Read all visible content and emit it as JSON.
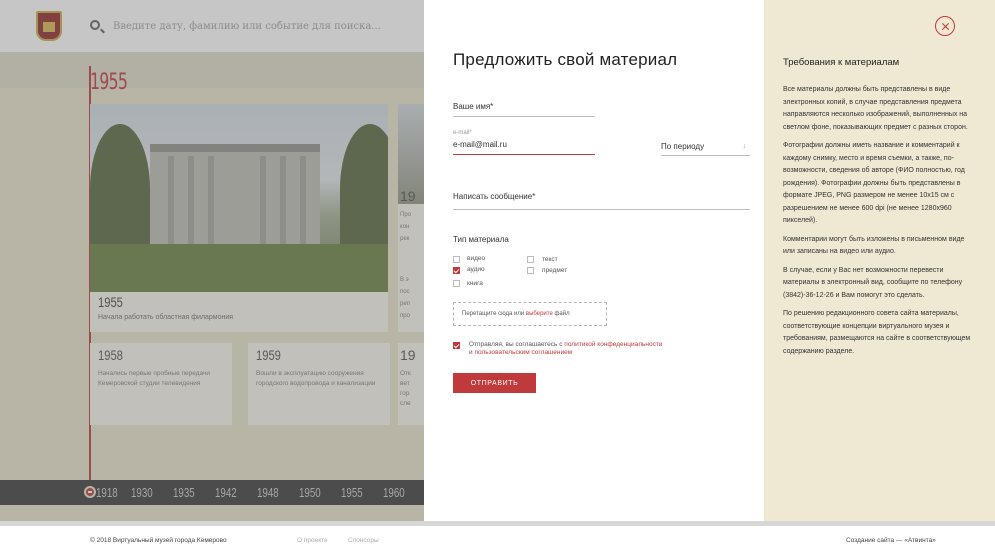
{
  "search": {
    "placeholder": "Введите дату, фамилию или событие для поиска..."
  },
  "timeline": {
    "current_year": "1955",
    "featured": {
      "year": "1955",
      "text": "Начала работать областная филармония"
    },
    "right_card": {
      "year": "19",
      "text_lines": [
        "Про",
        "кон",
        "рек"
      ],
      "text_lines2": [
        "В э",
        "пос",
        "реп",
        "про"
      ]
    },
    "small_cards": [
      {
        "year": "1958",
        "text": "Начались первые пробные передачи Кемеровской студии телевидения"
      },
      {
        "year": "1959",
        "text": "Вошли в эксплуатацию сооружения городского водопровода и канализации"
      }
    ],
    "small_card_partial": {
      "year": "19",
      "text_lines": [
        "Отк",
        "вет",
        "гор",
        "сле"
      ]
    },
    "years": [
      "1918",
      "1930",
      "1935",
      "1942",
      "1948",
      "1950",
      "1955",
      "1960"
    ]
  },
  "form": {
    "title": "Предложить свой материал",
    "name_label": "Ваше имя*",
    "email_label": "e-mail*",
    "email_value": "e-mail@mail.ru",
    "period_label": "По периоду",
    "message_label": "Написать сообщение*",
    "material_type_label": "Тип материала",
    "types": [
      {
        "label": "видео",
        "checked": false
      },
      {
        "label": "аудио",
        "checked": true
      },
      {
        "label": "книга",
        "checked": false
      },
      {
        "label": "текст",
        "checked": false
      },
      {
        "label": "предмет",
        "checked": false
      }
    ],
    "dropzone_text": "Перетащите сюда или",
    "dropzone_link": "выберите",
    "dropzone_suffix": "файл",
    "consent_prefix": "Отправляя, вы соглашаетесь с",
    "consent_link1": "политикой конфеденциальности",
    "consent_and": "и",
    "consent_link2": "пользовательским соглашением",
    "submit_label": "ОТПРАВИТЬ"
  },
  "requirements": {
    "title": "Требования к материалам",
    "paragraphs": [
      "Все материалы должны быть представлены в виде электронных копий, в случае представления предмета направляются несколько изображений, выполненных на светлом фоне, показывающих предмет с разных сторон.",
      "Фотографии должны иметь название и комментарий к каждому снимку, место и время съемки, а также, по-возможности, сведения об авторе (ФИО полностью, год рождения). Фотографии должны быть представлены в формате JPEG, PNG размером не менее 10x15 см с разрешением не менее 600 dpi (не менее 1280x960 пикселей).",
      "Комментарии могут быть изложены в письменном виде или записаны на видео или аудио.",
      "В случае, если у Вас нет возможности перевести материалы в электронный вид, сообщите по телефону (3842)-36-12-26 и Вам помогут это сделать.",
      "По решению редакционного совета сайта материалы, соответствующие концепции виртуального музея и требованиям, размещаются на сайте в соответствующем содержанию разделе."
    ]
  },
  "footer": {
    "copyright": "© 2018 Виртуальный музей города Кемерово",
    "about": "О проекте",
    "sponsors": "Спонсоры",
    "credit": "Создание сайта — «Атвинта»"
  },
  "colors": {
    "accent": "#c0393b",
    "side_panel": "#efe8d2",
    "page_bg": "#e9e2c9"
  }
}
